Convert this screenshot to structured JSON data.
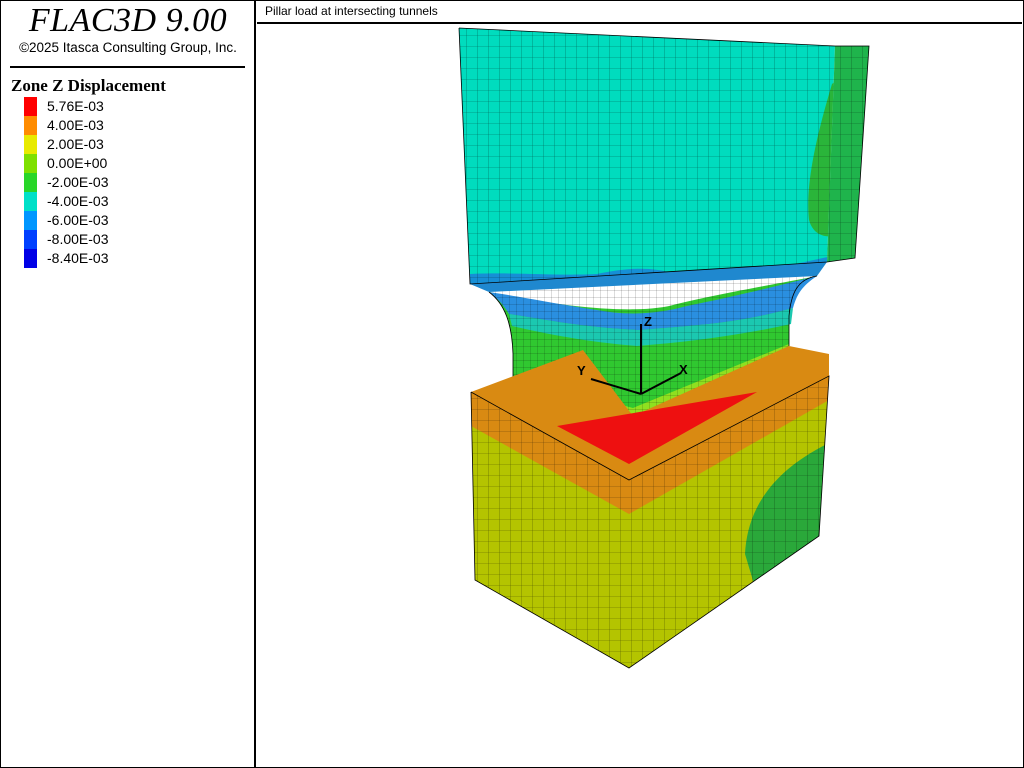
{
  "app": {
    "title": "FLAC3D 9.00",
    "copyright": "©2025 Itasca Consulting Group, Inc."
  },
  "legend": {
    "title": "Zone Z Displacement",
    "items": [
      {
        "label": "5.76E-03",
        "color": "#ff0000"
      },
      {
        "label": "4.00E-03",
        "color": "#ff8c00"
      },
      {
        "label": "2.00E-03",
        "color": "#e8ea00"
      },
      {
        "label": "0.00E+00",
        "color": "#7ee000"
      },
      {
        "label": "-2.00E-03",
        "color": "#28d628"
      },
      {
        "label": "-4.00E-03",
        "color": "#00e0c8"
      },
      {
        "label": "-6.00E-03",
        "color": "#0096ff"
      },
      {
        "label": "-8.00E-03",
        "color": "#0040ff"
      },
      {
        "label": "-8.40E-03",
        "color": "#0000e6"
      }
    ]
  },
  "view": {
    "title": "Pillar load at intersecting tunnels",
    "axes": {
      "x": "X",
      "y": "Y",
      "z": "Z"
    }
  }
}
